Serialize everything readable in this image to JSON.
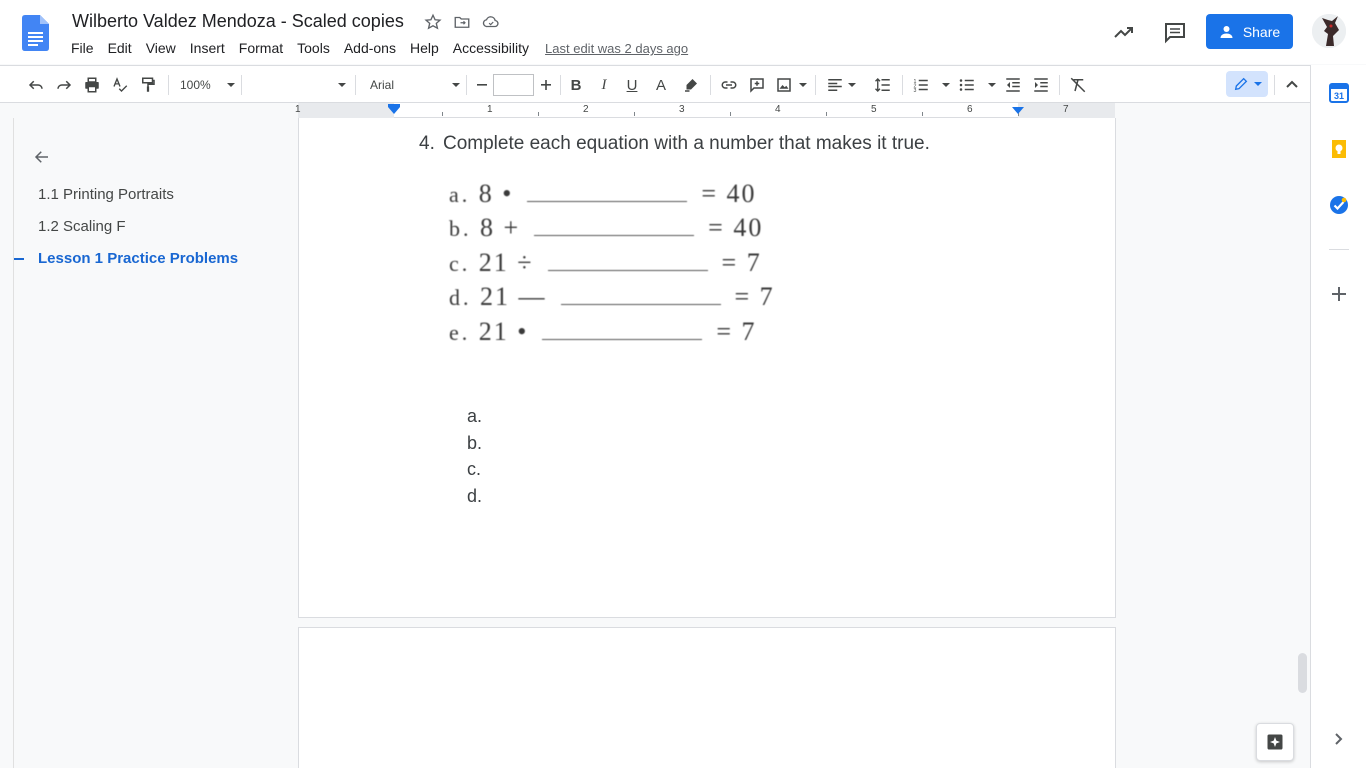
{
  "document": {
    "title": "Wilberto Valdez Mendoza - Scaled copies",
    "last_edit": "Last edit was 2 days ago"
  },
  "menu": [
    "File",
    "Edit",
    "View",
    "Insert",
    "Format",
    "Tools",
    "Add-ons",
    "Help",
    "Accessibility"
  ],
  "header": {
    "share_label": "Share",
    "title_icons": [
      "star-icon",
      "move-to-folder-icon",
      "cloud-saved-icon"
    ],
    "right_icons": [
      "activity-trend-icon",
      "comment-history-icon"
    ]
  },
  "toolbar": {
    "zoom": "100%",
    "style": "",
    "font": "Arial",
    "font_size": "",
    "icons": [
      "undo-icon",
      "redo-icon",
      "print-icon",
      "spellcheck-icon",
      "paint-format-icon",
      "bold-icon",
      "italic-icon",
      "underline-icon",
      "text-color-icon",
      "highlight-icon",
      "link-icon",
      "add-comment-icon",
      "insert-image-icon",
      "align-icon",
      "line-spacing-icon",
      "numbered-list-icon",
      "bulleted-list-icon",
      "decrease-indent-icon",
      "increase-indent-icon",
      "clear-formatting-icon",
      "editing-mode-icon",
      "collapse-menus-icon"
    ]
  },
  "ruler": {
    "labels": [
      "1",
      "1",
      "2",
      "3",
      "4",
      "5",
      "6",
      "7"
    ]
  },
  "outline": {
    "items": [
      {
        "label": "1.1 Printing Portraits",
        "active": false
      },
      {
        "label": "1.2 Scaling F",
        "active": false
      },
      {
        "label": "Lesson 1 Practice Problems",
        "active": true
      }
    ]
  },
  "content": {
    "question_number": "4.",
    "question_text": "Complete each equation with a number that makes it true.",
    "equations": [
      {
        "label": "a.",
        "left": "8  •",
        "right": "=  40"
      },
      {
        "label": "b.",
        "left": "8  +",
        "right": "=  40"
      },
      {
        "label": "c.",
        "left": "21  ÷",
        "right": "=  7"
      },
      {
        "label": "d.",
        "left": "21  —",
        "right": "=  7"
      },
      {
        "label": "e.",
        "left": "21  •",
        "right": "=  7"
      }
    ],
    "answers": [
      "a.",
      "b.",
      "c.",
      "d."
    ]
  },
  "side_panel": {
    "icons": [
      "calendar-icon",
      "keep-icon",
      "tasks-icon",
      "get-addons-icon"
    ],
    "calendar_day": "31"
  },
  "colors": {
    "accent": "#1a73e8",
    "active_outline": "#1967d2",
    "keep": "#fbbc04"
  }
}
